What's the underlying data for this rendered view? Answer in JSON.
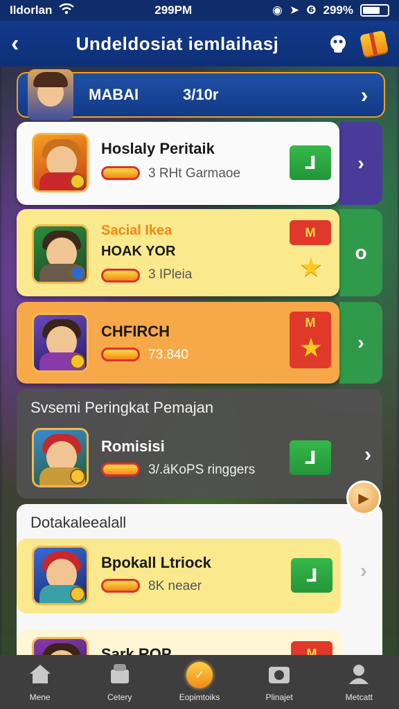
{
  "status_bar": {
    "carrier": "Ildorlan",
    "time": "299PM",
    "battery_pct": "299%"
  },
  "header": {
    "title": "Undeldosiat iemlaihasj"
  },
  "mabai_bar": {
    "label": "MABAI",
    "count": "3/10r"
  },
  "cards": [
    {
      "name": "Hoslaly Peritaik",
      "meta": "3 RHt Garmaoe",
      "action_label": "⅃"
    },
    {
      "subtitle": "Sacial Ikea",
      "name": "HOAK YOR",
      "meta": "3 IPleia",
      "badge": "M",
      "tab_label": "o"
    },
    {
      "name": "CHFIRCH",
      "meta": "73.840",
      "badge": "M"
    }
  ],
  "section_ranking": {
    "title": "Svsemi Peringkat Pemajan",
    "item": {
      "name": "Romisisi",
      "meta": "3/.äKoPS ringgers",
      "action_label": "⅃"
    }
  },
  "section_details": {
    "title": "Dotakaleealall",
    "items": [
      {
        "name": "Bpokall Ltriock",
        "meta": "8K neaer",
        "action_label": "⅃"
      },
      {
        "name": "Sark ROP",
        "badge": "M"
      }
    ]
  },
  "nav": [
    {
      "label": "Mene"
    },
    {
      "label": "Cetery"
    },
    {
      "label": "Eopimtoiks"
    },
    {
      "label": "Plinajet"
    },
    {
      "label": "Metcatt"
    }
  ]
}
